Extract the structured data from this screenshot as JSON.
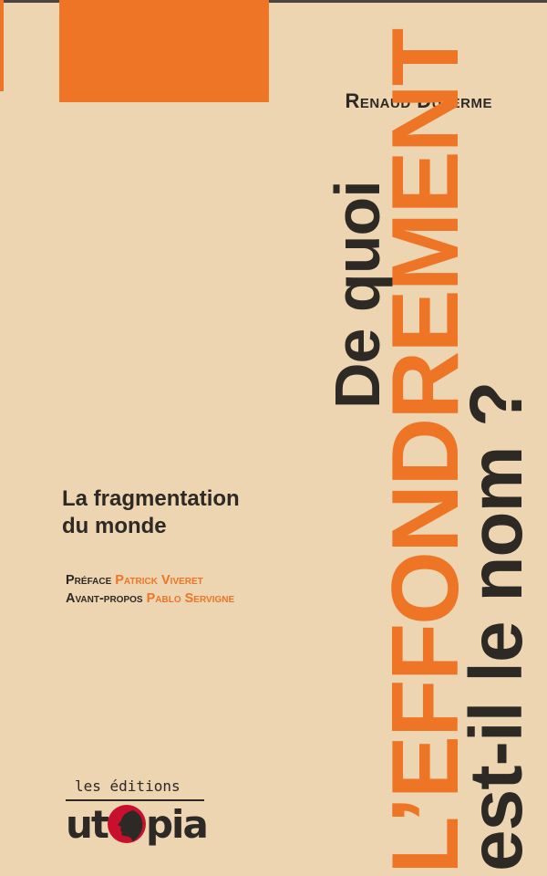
{
  "cover": {
    "author": "Renaud Duterme",
    "title": {
      "line1": "De quoi",
      "line2": "L’EFFONDREMENT",
      "line3": "est-il le nom ?"
    },
    "subtitle": {
      "line1": "La fragmentation",
      "line2": "du monde"
    },
    "credits": {
      "preface_label": "Préface",
      "preface_name": "Patrick Viveret",
      "foreword_label": "Avant-propos",
      "foreword_name": "Pablo Servigne"
    },
    "publisher": {
      "line1": "les éditions",
      "logo_left": "ut",
      "logo_right": "pia",
      "logo_full": "utopia"
    }
  },
  "colors": {
    "background": "#ecd5b0",
    "orange": "#ee7526",
    "dark": "#2d2925",
    "face_red": "#c8102e"
  },
  "icons": {
    "publisher_mark": "red-profile-face-icon"
  }
}
